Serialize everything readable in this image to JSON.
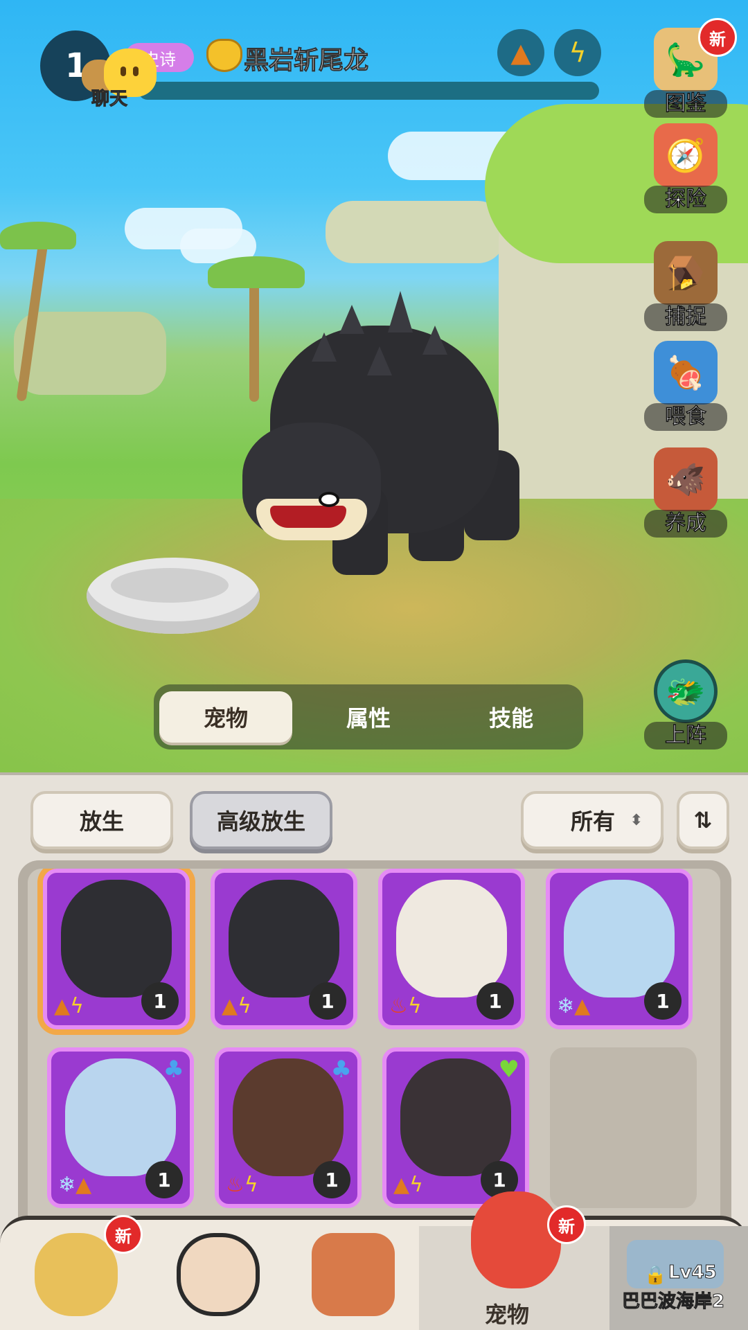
{
  "header": {
    "level": "1",
    "chat_label": "聊天",
    "rarity": "史诗",
    "pet_name": "黑岩斩尾龙",
    "type_icons": [
      "mountain-icon",
      "lightning-icon"
    ]
  },
  "side_menu": {
    "items": [
      {
        "label": "图鉴",
        "icon": "book-icon",
        "badge": "新"
      },
      {
        "label": "探险",
        "icon": "adventure-icon"
      },
      {
        "label": "捕捉",
        "icon": "cage-icon"
      },
      {
        "label": "喂食",
        "icon": "feed-icon"
      },
      {
        "label": "养成",
        "icon": "train-icon"
      },
      {
        "label": "上阵",
        "icon": "deploy-icon"
      }
    ]
  },
  "scene_tabs": {
    "items": [
      "宠物",
      "属性",
      "技能"
    ],
    "active": "宠物"
  },
  "toolbar": {
    "release_label": "放生",
    "advanced_release_label": "高级放生",
    "filter_label": "所有",
    "sort_icon": "sort-icon"
  },
  "pet_cards": [
    {
      "count": "1",
      "types": [
        "mountain",
        "lightning"
      ],
      "selected": true
    },
    {
      "count": "1",
      "types": [
        "mountain",
        "lightning"
      ]
    },
    {
      "count": "1",
      "types": [
        "fire",
        "lightning"
      ]
    },
    {
      "count": "1",
      "types": [
        "ice",
        "mountain"
      ]
    },
    {
      "count": "1",
      "types": [
        "ice",
        "mountain"
      ],
      "corner": "water"
    },
    {
      "count": "1",
      "types": [
        "fire",
        "lightning"
      ],
      "corner": "water"
    },
    {
      "count": "1",
      "types": [
        "mountain",
        "lightning"
      ],
      "corner": "heal"
    }
  ],
  "bottom_nav": {
    "new_badge": "新",
    "pets_label": "宠物",
    "map_level": "Lv45",
    "map_name": "巴巴波海岸2"
  }
}
